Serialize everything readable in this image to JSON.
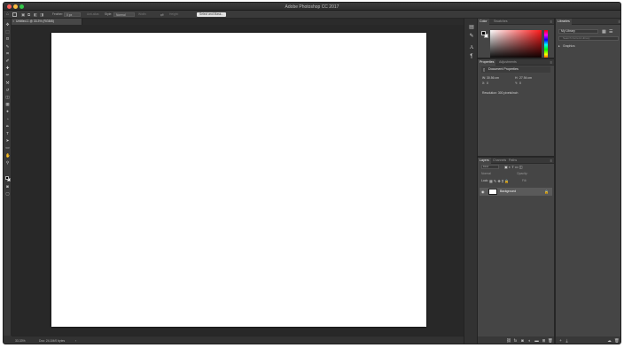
{
  "window": {
    "title": "Adobe Photoshop CC 2017"
  },
  "options_bar": {
    "feather_label": "Feather:",
    "feather_value": "0 px",
    "antialias_label": "Anti-alias",
    "style_label": "Style:",
    "style_value": "Normal",
    "width_label": "Width:",
    "height_label": "Height:",
    "select_mask_button": "Select and Mask..."
  },
  "document": {
    "tab_label": "Untitled-1 @ 33.3% (RGB/8)",
    "canvas_color": "#ffffff"
  },
  "status_bar": {
    "zoom": "33.33%",
    "doc_size": "Doc: 24.1M/0 bytes"
  },
  "color_panel": {
    "tabs": [
      "Color",
      "Swatches"
    ],
    "hue_color": "#ff1a1a"
  },
  "properties_panel": {
    "tabs": [
      "Properties",
      "Adjustments"
    ],
    "section_title": "Document Properties",
    "w_label": "W:",
    "w_value": "30.56 cm",
    "h_label": "H:",
    "h_value": "27.94 cm",
    "x_label": "X:",
    "x_value": "0",
    "y_label": "Y:",
    "y_value": "0",
    "resolution": "Resolution: 300 pixels/inch"
  },
  "layers_panel": {
    "tabs": [
      "Layers",
      "Channels",
      "Paths"
    ],
    "kind_filter": "Kind",
    "blend_mode": "Normal",
    "opacity_label": "Opacity:",
    "lock_label": "Lock:",
    "fill_label": "Fill:",
    "layers": [
      {
        "name": "Background",
        "locked": true,
        "visible": true
      }
    ]
  },
  "libraries_panel": {
    "tab": "Libraries",
    "library_select": "My Library",
    "search_placeholder": "Search Current Library",
    "group_label": "Graphics"
  },
  "icons": {
    "tools": [
      "move-icon",
      "marquee-icon",
      "lasso-icon",
      "quick-select-icon",
      "crop-icon",
      "eyedropper-icon",
      "healing-icon",
      "brush-icon",
      "stamp-icon",
      "history-brush-icon",
      "eraser-icon",
      "gradient-icon",
      "blur-icon",
      "dodge-icon",
      "pen-icon",
      "type-icon",
      "path-select-icon",
      "shape-icon",
      "hand-icon",
      "zoom-icon"
    ],
    "glyphs": [
      "✥",
      "⬚",
      "ʘ",
      "✎",
      "⌗",
      "✐",
      "✚",
      "✏",
      "⚒",
      "↺",
      "◫",
      "▦",
      "●",
      "◔",
      "✒",
      "T",
      "➤",
      "▭",
      "✋",
      "⚲"
    ],
    "panel_strip": [
      "history-icon",
      "brush-settings-icon",
      "character-icon",
      "paragraph-icon"
    ]
  }
}
